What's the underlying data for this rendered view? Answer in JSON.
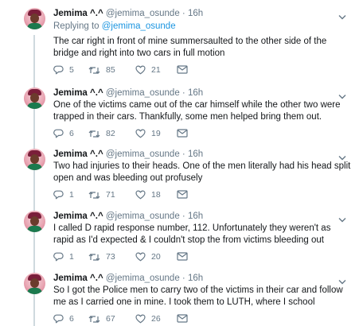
{
  "tweets": [
    {
      "name": "Jemima ^.^",
      "handle": "@jemima_osunde",
      "dot": "·",
      "time": "16h",
      "replying_prefix": "Replying to ",
      "replying_handle": "@jemima_osunde",
      "text": "The car right in front of mine summersaulted to the other side of the bridge and right into two cars in full motion",
      "replies": "5",
      "retweets": "85",
      "likes": "21"
    },
    {
      "name": "Jemima ^.^",
      "handle": "@jemima_osunde",
      "dot": "·",
      "time": "16h",
      "text": "One of the victims came out of the car himself while the other two were trapped in their cars. Thankfully, some men helped bring them out.",
      "replies": "6",
      "retweets": "82",
      "likes": "19"
    },
    {
      "name": "Jemima ^.^",
      "handle": "@jemima_osunde",
      "dot": "·",
      "time": "16h",
      "text": "Two had injuries to their heads. One of the men literally had his head split open and was bleeding out profusely",
      "replies": "1",
      "retweets": "71",
      "likes": "18"
    },
    {
      "name": "Jemima ^.^",
      "handle": "@jemima_osunde",
      "dot": "·",
      "time": "16h",
      "text": "I called D rapid response number, 112. Unfortunately they weren't as rapid as I'd expected & I couldn't stop the from victims bleeding out",
      "replies": "1",
      "retweets": "73",
      "likes": "20"
    },
    {
      "name": "Jemima ^.^",
      "handle": "@jemima_osunde",
      "dot": "·",
      "time": "16h",
      "text": "So I got the Police men to carry two of the victims in their car and follow me as I carried one in mine. I took them to LUTH, where I school",
      "replies": "6",
      "retweets": "67",
      "likes": "26"
    }
  ],
  "colors": {
    "text": "#14171a",
    "secondary": "#657786",
    "link": "#1b95e0",
    "thread_line": "#cfd9de"
  },
  "icons": {
    "reply": "reply-icon",
    "retweet": "retweet-icon",
    "like": "like-icon",
    "dm": "message-icon",
    "more": "chevron-down-icon"
  }
}
